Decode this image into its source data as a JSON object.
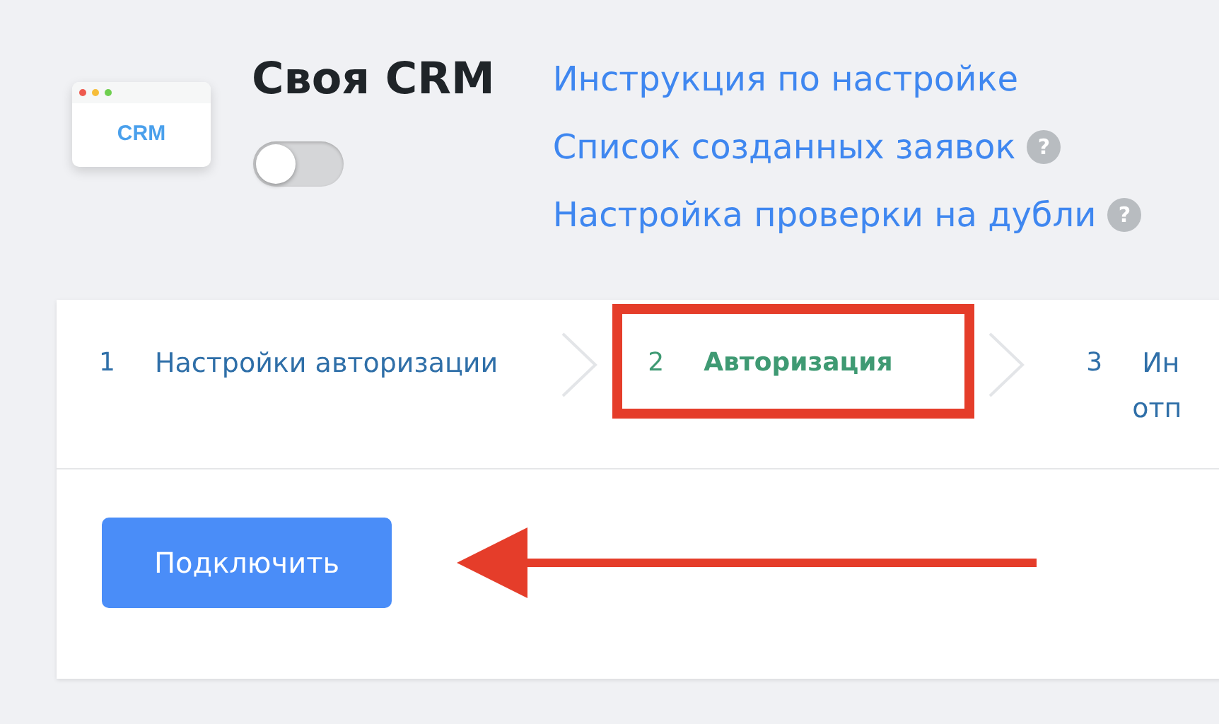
{
  "app": {
    "logo_text": "CRM",
    "title": "Своя CRM",
    "enabled": false
  },
  "links": [
    {
      "label": "Инструкция по настройке"
    },
    {
      "label": "Список созданных заявок",
      "help_mark": "?"
    },
    {
      "label": "Настройка проверки на дубли",
      "help_mark": "?"
    }
  ],
  "steps": [
    {
      "number": "1",
      "lines": [
        "Настройки авторизации"
      ],
      "selected": false,
      "annotated": false
    },
    {
      "number": "2",
      "lines": [
        "Авторизация"
      ],
      "selected": true,
      "annotated": true
    },
    {
      "number": "3",
      "lines": [
        "Ин",
        "отп"
      ],
      "selected": false,
      "annotated": false
    }
  ],
  "connect_button": {
    "label": "Подключить"
  }
}
